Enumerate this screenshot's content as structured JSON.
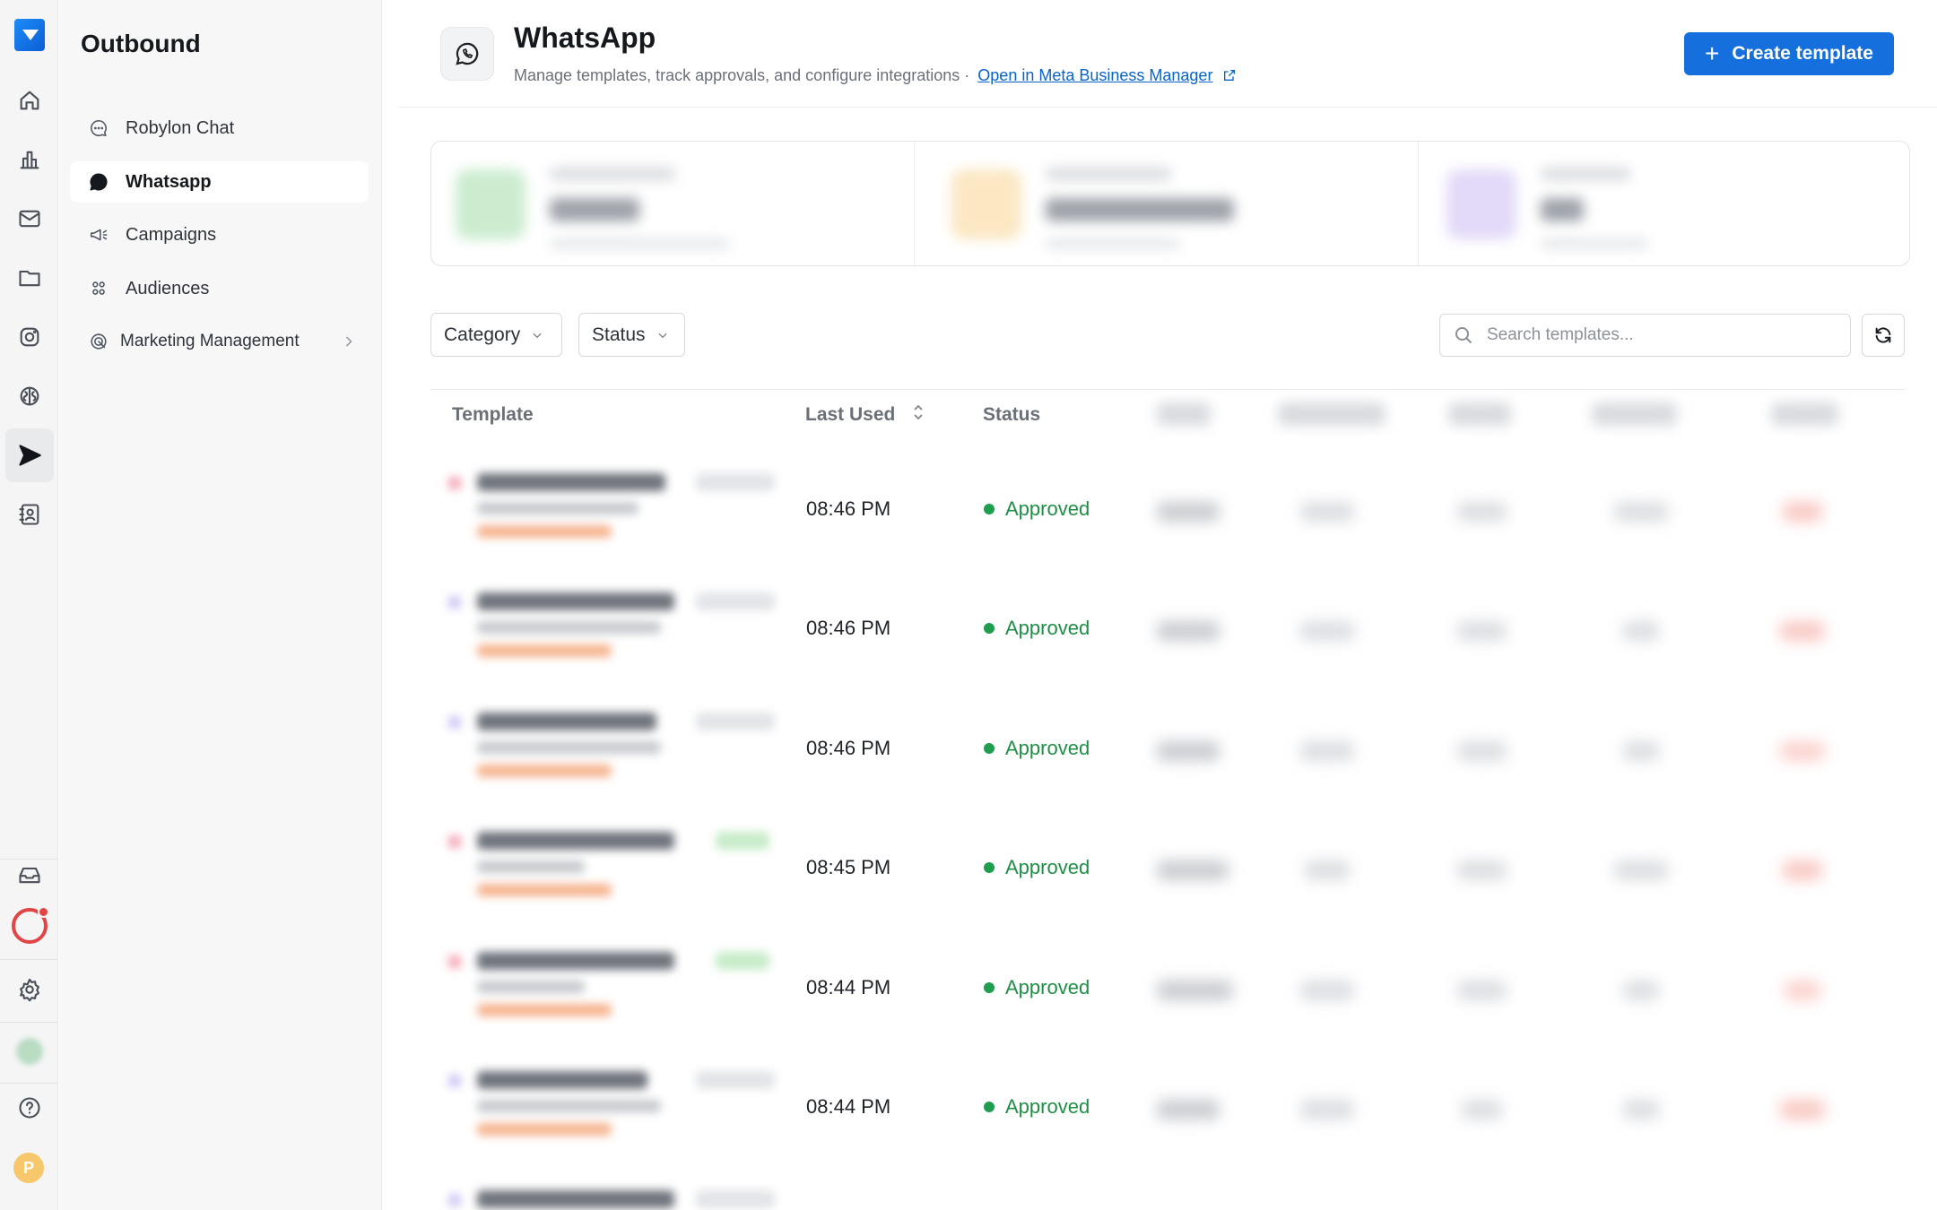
{
  "rail": {
    "icons": [
      "home-icon",
      "analytics-icon",
      "mail-icon",
      "folder-icon",
      "instagram-icon",
      "brain-icon",
      "send-icon",
      "contacts-icon",
      "inbox-icon",
      "settings-icon",
      "help-icon"
    ],
    "active": "send-icon",
    "avatar_initial": "P"
  },
  "sidebar": {
    "title": "Outbound",
    "items": [
      {
        "label": "Robylon Chat",
        "icon": "chat-bubble-icon"
      },
      {
        "label": "Whatsapp",
        "icon": "whatsapp-icon",
        "active": true
      },
      {
        "label": "Campaigns",
        "icon": "megaphone-icon"
      },
      {
        "label": "Audiences",
        "icon": "users-icon"
      },
      {
        "label": "Marketing Management",
        "icon": "marketing-icon",
        "has_children": true
      }
    ]
  },
  "header": {
    "title": "WhatsApp",
    "subtitle": "Manage templates, track approvals, and configure integrations ·",
    "link_label": "Open in Meta Business Manager",
    "create_label": "Create template",
    "accent": "#1570dd"
  },
  "filters": {
    "category_label": "Category",
    "status_label": "Status",
    "search_placeholder": "Search templates..."
  },
  "table": {
    "columns": {
      "template": "Template",
      "last_used": "Last Used",
      "status": "Status"
    },
    "rows": [
      {
        "last_used": "08:46 PM",
        "status": "Approved"
      },
      {
        "last_used": "08:46 PM",
        "status": "Approved"
      },
      {
        "last_used": "08:46 PM",
        "status": "Approved"
      },
      {
        "last_used": "08:45 PM",
        "status": "Approved"
      },
      {
        "last_used": "08:44 PM",
        "status": "Approved"
      },
      {
        "last_used": "08:44 PM",
        "status": "Approved"
      }
    ],
    "status_color": "#1f8f47"
  }
}
